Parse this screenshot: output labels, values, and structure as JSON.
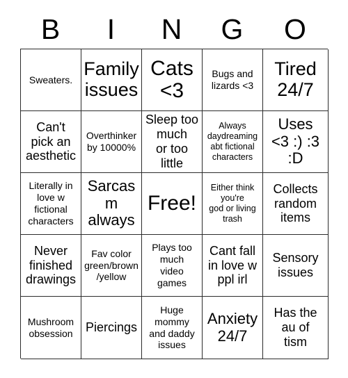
{
  "title": "BINGO",
  "header": {
    "letters": [
      "B",
      "I",
      "N",
      "G",
      "O"
    ]
  },
  "grid": {
    "columns": 5,
    "rows": 5,
    "free_space_label": "Free!",
    "cells": [
      {
        "text": "Sweaters.",
        "size": "sm"
      },
      {
        "text": "Family\nissues",
        "size": "xl"
      },
      {
        "text": "Cats\n<3",
        "size": "xxl"
      },
      {
        "text": "Bugs and\nlizards <3",
        "size": "sm"
      },
      {
        "text": "Tired\n24/7",
        "size": "xl"
      },
      {
        "text": "Can't\npick an\naesthetic",
        "size": "md"
      },
      {
        "text": "Overthinker\nby 10000%",
        "size": "sm"
      },
      {
        "text": "Sleep too\nmuch\nor too little",
        "size": "md"
      },
      {
        "text": "Always\ndaydreaming\nabt fictional\ncharacters",
        "size": "xs"
      },
      {
        "text": "Uses\n<3 :) :3\n:D",
        "size": "lg"
      },
      {
        "text": "Literally in\nlove w\nfictional\ncharacters",
        "size": "sm"
      },
      {
        "text": "Sarcasm\nalways",
        "size": "lg"
      },
      {
        "text": "Free!",
        "size": "xxl"
      },
      {
        "text": "Either think\nyou're\ngod or living\ntrash",
        "size": "xs"
      },
      {
        "text": "Collects\nrandom\nitems",
        "size": "md"
      },
      {
        "text": "Never\nfinished\ndrawings",
        "size": "md"
      },
      {
        "text": "Fav color\ngreen/brown\n/yellow",
        "size": "sm"
      },
      {
        "text": "Plays too\nmuch\nvideo\ngames",
        "size": "sm"
      },
      {
        "text": "Cant fall\nin love w\nppl irl",
        "size": "md"
      },
      {
        "text": "Sensory\nissues",
        "size": "md"
      },
      {
        "text": "Mushroom\nobsession",
        "size": "sm"
      },
      {
        "text": "Piercings",
        "size": "md"
      },
      {
        "text": "Huge\nmommy\nand daddy\nissues",
        "size": "sm"
      },
      {
        "text": "Anxiety\n24/7",
        "size": "lg"
      },
      {
        "text": "Has the\nau of\ntism",
        "size": "md"
      }
    ]
  },
  "colors": {
    "background": "#ffffff",
    "border": "#2b2b2b",
    "text": "#000000"
  }
}
